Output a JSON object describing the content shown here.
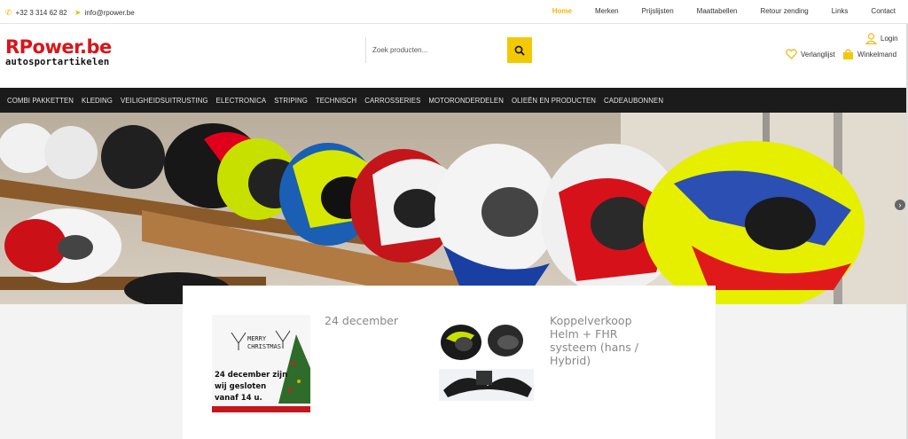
{
  "topbar": {
    "phone": "+32 3 314 62 82",
    "email": "info@rpower.be",
    "nav": [
      "Home",
      "Merken",
      "Prijslijsten",
      "Maattabellen",
      "Retour zending",
      "Links",
      "Contact"
    ]
  },
  "header": {
    "logo_main": "RPower.be",
    "logo_sub": "autosportartikelen",
    "search_placeholder": "Zoek producten...",
    "login": "Login",
    "wishlist": "Verlanglijst",
    "cart": "Winkelmand"
  },
  "categories": [
    "COMBI PAKKETTEN",
    "KLEDING",
    "VEILIGHEIDSUITRUSTING",
    "ELECTRONICA",
    "STRIPING",
    "TECHNISCH",
    "CARROSSERIES",
    "MOTORONDERDELEN",
    "OLIEËN EN PRODUCTEN",
    "CADEAUBONNEN"
  ],
  "posts": [
    {
      "title": "24 december",
      "image_text": {
        "line1": "MERRY",
        "line2": "CHRISTMAS",
        "line3": "24 december zijn",
        "line4": "wij gesloten",
        "line5": "vanaf 14 u."
      }
    },
    {
      "title_lines": [
        "Koppelverkoop",
        "Helm + FHR",
        "systeem (hans /",
        "Hybrid)"
      ]
    }
  ],
  "colors": {
    "accent": "#f2c904",
    "logo_red": "#d9151b",
    "nav_bg": "#1b1b1b"
  }
}
